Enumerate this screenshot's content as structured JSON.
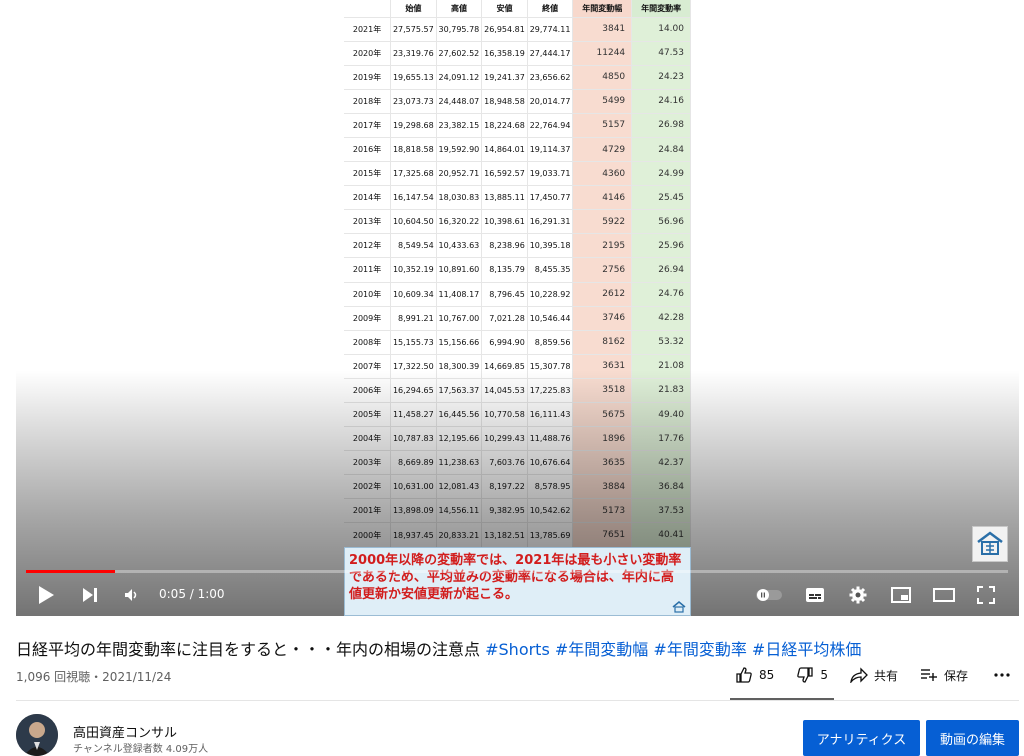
{
  "table": {
    "headers": [
      "",
      "始値",
      "高値",
      "安値",
      "終値",
      "年間変動幅",
      "年間変動率"
    ],
    "rows": [
      [
        "2021年",
        "27,575.57",
        "30,795.78",
        "26,954.81",
        "29,774.11",
        "3841",
        "14.00"
      ],
      [
        "2020年",
        "23,319.76",
        "27,602.52",
        "16,358.19",
        "27,444.17",
        "11244",
        "47.53"
      ],
      [
        "2019年",
        "19,655.13",
        "24,091.12",
        "19,241.37",
        "23,656.62",
        "4850",
        "24.23"
      ],
      [
        "2018年",
        "23,073.73",
        "24,448.07",
        "18,948.58",
        "20,014.77",
        "5499",
        "24.16"
      ],
      [
        "2017年",
        "19,298.68",
        "23,382.15",
        "18,224.68",
        "22,764.94",
        "5157",
        "26.98"
      ],
      [
        "2016年",
        "18,818.58",
        "19,592.90",
        "14,864.01",
        "19,114.37",
        "4729",
        "24.84"
      ],
      [
        "2015年",
        "17,325.68",
        "20,952.71",
        "16,592.57",
        "19,033.71",
        "4360",
        "24.99"
      ],
      [
        "2014年",
        "16,147.54",
        "18,030.83",
        "13,885.11",
        "17,450.77",
        "4146",
        "25.45"
      ],
      [
        "2013年",
        "10,604.50",
        "16,320.22",
        "10,398.61",
        "16,291.31",
        "5922",
        "56.96"
      ],
      [
        "2012年",
        "8,549.54",
        "10,433.63",
        "8,238.96",
        "10,395.18",
        "2195",
        "25.96"
      ],
      [
        "2011年",
        "10,352.19",
        "10,891.60",
        "8,135.79",
        "8,455.35",
        "2756",
        "26.94"
      ],
      [
        "2010年",
        "10,609.34",
        "11,408.17",
        "8,796.45",
        "10,228.92",
        "2612",
        "24.76"
      ],
      [
        "2009年",
        "8,991.21",
        "10,767.00",
        "7,021.28",
        "10,546.44",
        "3746",
        "42.28"
      ],
      [
        "2008年",
        "15,155.73",
        "15,156.66",
        "6,994.90",
        "8,859.56",
        "8162",
        "53.32"
      ],
      [
        "2007年",
        "17,322.50",
        "18,300.39",
        "14,669.85",
        "15,307.78",
        "3631",
        "21.08"
      ],
      [
        "2006年",
        "16,294.65",
        "17,563.37",
        "14,045.53",
        "17,225.83",
        "3518",
        "21.83"
      ],
      [
        "2005年",
        "11,458.27",
        "16,445.56",
        "10,770.58",
        "16,111.43",
        "5675",
        "49.40"
      ],
      [
        "2004年",
        "10,787.83",
        "12,195.66",
        "10,299.43",
        "11,488.76",
        "1896",
        "17.76"
      ],
      [
        "2003年",
        "8,669.89",
        "11,238.63",
        "7,603.76",
        "10,676.64",
        "3635",
        "42.37"
      ],
      [
        "2002年",
        "10,631.00",
        "12,081.43",
        "8,197.22",
        "8,578.95",
        "3884",
        "36.84"
      ],
      [
        "2001年",
        "13,898.09",
        "14,556.11",
        "9,382.95",
        "10,542.62",
        "5173",
        "37.53"
      ],
      [
        "2000年",
        "18,937.45",
        "20,833.21",
        "13,182.51",
        "13,785.69",
        "7651",
        "40.41"
      ]
    ]
  },
  "caption": "2000年以降の変動率では、2021年は最も小さい変動率であるため、平均並みの変動率になる場合は、年内に高値更新か安値更新が起こる。",
  "player": {
    "time": "0:05 / 1:00",
    "progress_fraction": 0.091,
    "accent": "#ff0000"
  },
  "video": {
    "title_main": "日経平均の年間変動率に注目をすると・・・年内の相場の注意点",
    "hashtags": [
      "#Shorts",
      "#年間変動幅",
      "#年間変動率",
      "#日経平均株価"
    ],
    "meta": "1,096 回視聴・2021/11/24"
  },
  "actions": {
    "likes": "85",
    "dislikes": "5",
    "share_label": "共有",
    "save_label": "保存"
  },
  "channel": {
    "name": "高田資産コンサル",
    "subscribers": "チャンネル登録者数 4.09万人"
  },
  "buttons": {
    "analytics": "アナリティクス",
    "edit": "動画の編集"
  },
  "icons": [
    "play-icon",
    "next-icon",
    "volume-icon",
    "autoplay-toggle-icon",
    "subtitles-icon",
    "settings-icon",
    "miniplayer-icon",
    "theater-icon",
    "fullscreen-icon",
    "like-icon",
    "dislike-icon",
    "share-icon",
    "save-icon",
    "more-icon"
  ]
}
